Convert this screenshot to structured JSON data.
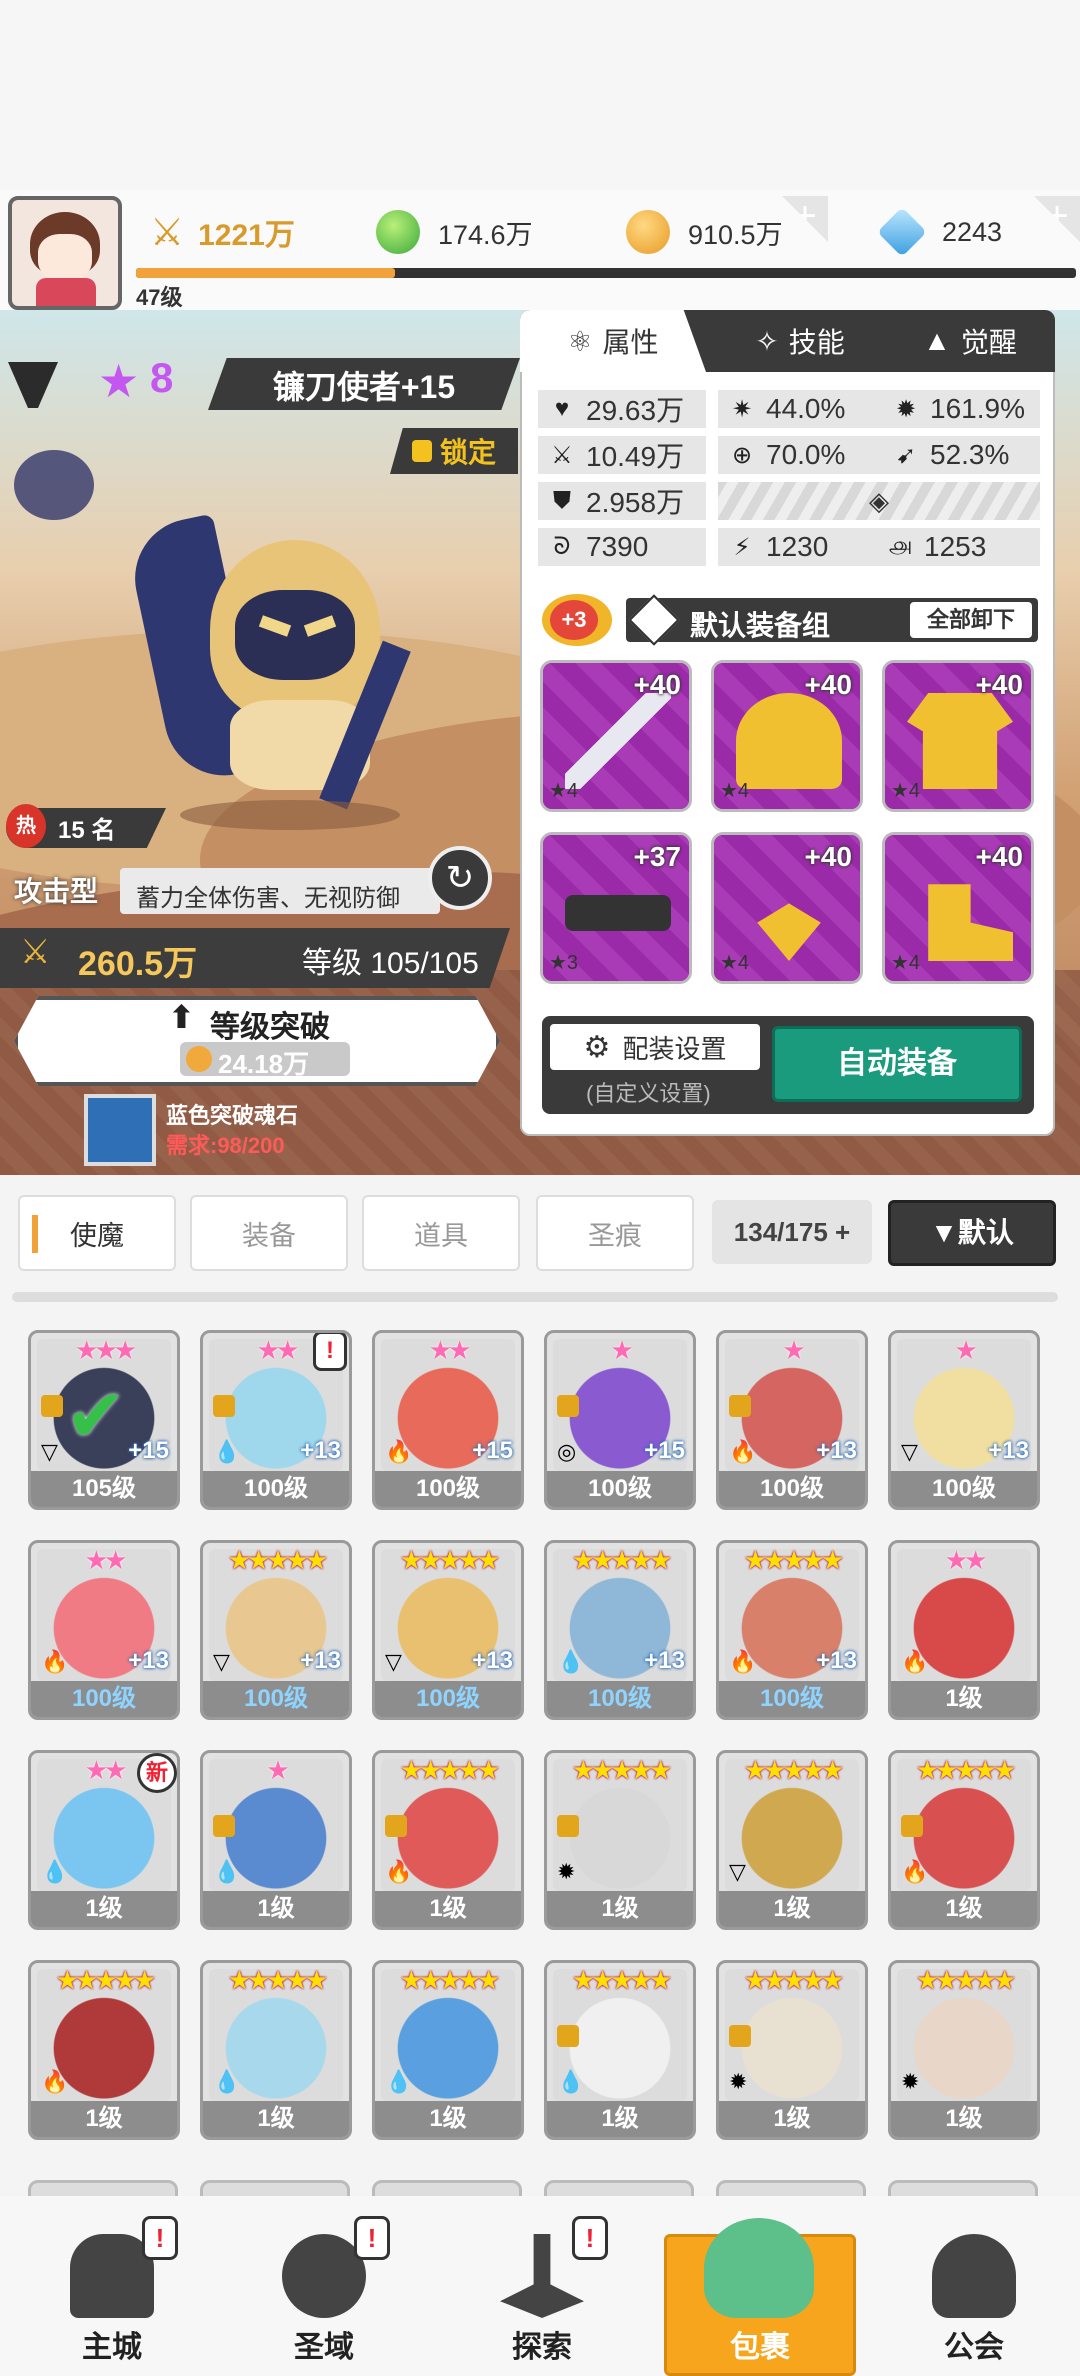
{
  "top": {
    "power": "1221万",
    "green_gem": "174.6万",
    "gold": "910.5万",
    "diamond": "2243",
    "player_level": "47级"
  },
  "hero": {
    "name": "镰刀使者+15",
    "star_count": "8",
    "lock_label": "锁定",
    "hot_rank": "15 名",
    "type": "攻击型",
    "description": "蓄力全体伤害、无视防御",
    "power": "260.5万",
    "level": "等级 105/105",
    "breakthrough_label": "等级突破",
    "breakthrough_cost": "24.18万",
    "material_name": "蓝色突破魂石",
    "material_need": "需求:98/200"
  },
  "panel": {
    "tabs": [
      "属性",
      "技能",
      "觉醒"
    ],
    "stats": {
      "hp": "29.63万",
      "crit": "44.0%",
      "crit_dmg": "161.9%",
      "atk": "10.49万",
      "hit": "70.0%",
      "speed": "52.3%",
      "def": "2.958万",
      "s1": "7390",
      "s2": "1230",
      "s3": "1253"
    },
    "equip_bonus": "+3",
    "equip_set": "默认装备组",
    "unequip_all": "全部卸下",
    "equipment": [
      {
        "plus": "+40",
        "stars": "★4",
        "color": "#a02fb0"
      },
      {
        "plus": "+40",
        "stars": "★4",
        "color": "#a02fb0"
      },
      {
        "plus": "+40",
        "stars": "★4",
        "color": "#a02fb0"
      },
      {
        "plus": "+37",
        "stars": "★3",
        "color": "#a02fb0"
      },
      {
        "plus": "+40",
        "stars": "★4",
        "color": "#a02fb0"
      },
      {
        "plus": "+40",
        "stars": "★4",
        "color": "#a02fb0"
      }
    ],
    "config_label": "配装设置",
    "config_sub": "(自定义设置)",
    "auto_equip": "自动装备"
  },
  "inventory": {
    "tabs": [
      "使魔",
      "装备",
      "道具",
      "圣痕"
    ],
    "count": "134/175",
    "sort": "▼默认",
    "cards": [
      {
        "stars": "★★★",
        "pink": true,
        "plus": "+15",
        "level": "105级",
        "blue": false,
        "color": "#3a3f5a",
        "check": true,
        "lock": true,
        "elem": "▽"
      },
      {
        "stars": "★★",
        "pink": true,
        "plus": "+13",
        "level": "100级",
        "blue": false,
        "color": "#9fd7ec",
        "badge": "!",
        "lock": true,
        "elem": "💧"
      },
      {
        "stars": "★★",
        "pink": true,
        "plus": "+15",
        "level": "100级",
        "blue": false,
        "color": "#e86a5a",
        "elem": "🔥"
      },
      {
        "stars": "★",
        "pink": true,
        "plus": "+15",
        "level": "100级",
        "blue": false,
        "color": "#8a5ad0",
        "lock": true,
        "elem": "◎"
      },
      {
        "stars": "★",
        "pink": true,
        "plus": "+13",
        "level": "100级",
        "blue": false,
        "color": "#d56560",
        "lock": true,
        "elem": "🔥"
      },
      {
        "stars": "★",
        "pink": true,
        "plus": "+13",
        "level": "100级",
        "blue": false,
        "color": "#f0dfa0",
        "elem": "▽"
      },
      {
        "stars": "★★",
        "pink": true,
        "plus": "+13",
        "level": "100级",
        "blue": true,
        "color": "#f07b85",
        "elem": "🔥"
      },
      {
        "stars": "★★★★★",
        "pink": false,
        "plus": "+13",
        "level": "100级",
        "blue": true,
        "color": "#e8c890",
        "elem": "▽"
      },
      {
        "stars": "★★★★★",
        "pink": false,
        "plus": "+13",
        "level": "100级",
        "blue": true,
        "color": "#e8c070",
        "elem": "▽"
      },
      {
        "stars": "★★★★★",
        "pink": false,
        "plus": "+13",
        "level": "100级",
        "blue": true,
        "color": "#8fb8d8",
        "elem": "💧"
      },
      {
        "stars": "★★★★★",
        "pink": false,
        "plus": "+13",
        "level": "100级",
        "blue": true,
        "color": "#d8806a",
        "elem": "🔥"
      },
      {
        "stars": "★★",
        "pink": true,
        "plus": "",
        "level": "1级",
        "blue": false,
        "color": "#d84a4a",
        "elem": "🔥"
      },
      {
        "stars": "★★",
        "pink": true,
        "plus": "",
        "level": "1级",
        "blue": false,
        "color": "#7ac6f0",
        "badge": "新",
        "elem": "💧"
      },
      {
        "stars": "★",
        "pink": true,
        "plus": "",
        "level": "1级",
        "blue": false,
        "color": "#5a8ad0",
        "lock": true,
        "elem": "💧"
      },
      {
        "stars": "★★★★★",
        "pink": false,
        "plus": "",
        "level": "1级",
        "blue": false,
        "color": "#e05a5a",
        "lock": true,
        "elem": "🔥"
      },
      {
        "stars": "★★★★★",
        "pink": false,
        "plus": "",
        "level": "1级",
        "blue": false,
        "color": "#d8d8d8",
        "lock": true,
        "elem": "✹"
      },
      {
        "stars": "★★★★★",
        "pink": false,
        "plus": "",
        "level": "1级",
        "blue": false,
        "color": "#d0a850",
        "elem": "▽"
      },
      {
        "stars": "★★★★★",
        "pink": false,
        "plus": "",
        "level": "1级",
        "blue": false,
        "color": "#d85050",
        "lock": true,
        "elem": "🔥"
      },
      {
        "stars": "★★★★★",
        "pink": false,
        "plus": "",
        "level": "1级",
        "blue": false,
        "color": "#b03a3a",
        "elem": "🔥"
      },
      {
        "stars": "★★★★★",
        "pink": false,
        "plus": "",
        "level": "1级",
        "blue": false,
        "color": "#a8d8ec",
        "elem": "💧"
      },
      {
        "stars": "★★★★★",
        "pink": false,
        "plus": "",
        "level": "1级",
        "blue": false,
        "color": "#5aa0e0",
        "elem": "💧"
      },
      {
        "stars": "★★★★★",
        "pink": false,
        "plus": "",
        "level": "1级",
        "blue": false,
        "color": "#f0f0f0",
        "lock": true,
        "elem": "💧"
      },
      {
        "stars": "★★★★★",
        "pink": false,
        "plus": "",
        "level": "1级",
        "blue": false,
        "color": "#e8e0d0",
        "lock": true,
        "elem": "✹"
      },
      {
        "stars": "★★★★★",
        "pink": false,
        "plus": "",
        "level": "1级",
        "blue": false,
        "color": "#e8d6c8",
        "elem": "✹"
      }
    ]
  },
  "nav": {
    "items": [
      "主城",
      "圣域",
      "探索",
      "包裹",
      "公会"
    ],
    "active": "包裹"
  },
  "colors": {
    "accent_orange": "#f1a23b",
    "auto_equip_green": "#1a9b7e",
    "nav_active": "#f7a51d"
  }
}
